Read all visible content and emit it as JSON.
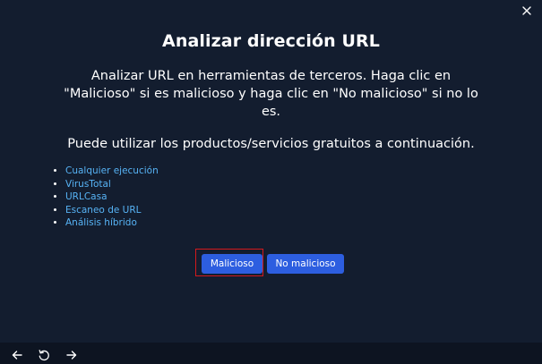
{
  "dialog": {
    "title": "Analizar dirección URL",
    "description": "Analizar URL en herramientas de terceros. Haga clic en \"Malicioso\" si es malicioso y haga clic en \"No malicioso\" si no lo es.",
    "free_services_text": "Puede utilizar los productos/servicios gratuitos a continuación.",
    "services": [
      {
        "label": "Cualquier ejecución"
      },
      {
        "label": "VirusTotal"
      },
      {
        "label": "URLCasa"
      },
      {
        "label": "Escaneo de URL"
      },
      {
        "label": "Análisis híbrido"
      }
    ],
    "buttons": {
      "malicious_label": "Malicioso",
      "not_malicious_label": "No malicioso"
    }
  },
  "icons": {
    "close": "close-icon",
    "back": "arrow-left-icon",
    "reload": "reload-icon",
    "forward": "arrow-right-icon"
  },
  "colors": {
    "background": "#131d2f",
    "bottom_bar": "#0d1421",
    "link": "#57b3f5",
    "button": "#2d5ee0",
    "highlight": "#d4191c"
  }
}
